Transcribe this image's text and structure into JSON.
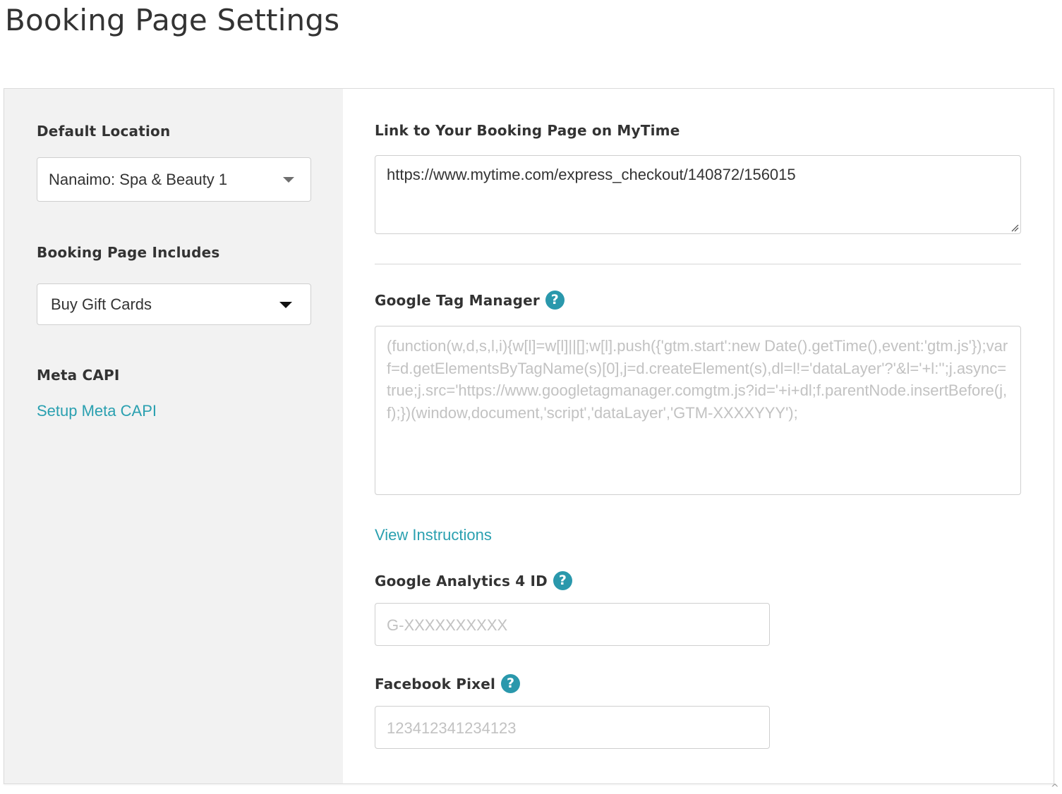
{
  "page": {
    "title": "Booking Page Settings"
  },
  "sidebar": {
    "default_location": {
      "label": "Default Location",
      "value": "Nanaimo: Spa & Beauty 1"
    },
    "booking_page_includes": {
      "label": "Booking Page Includes",
      "value": "Buy Gift Cards"
    },
    "meta_capi": {
      "label": "Meta CAPI",
      "link": "Setup Meta CAPI"
    }
  },
  "main": {
    "booking_link": {
      "label": "Link to Your Booking Page on MyTime",
      "value": "https://www.mytime.com/express_checkout/140872/156015"
    },
    "gtm": {
      "label": "Google Tag Manager",
      "help_icon": "?",
      "placeholder": "(function(w,d,s,l,i){w[l]=w[l]||[];w[l].push({'gtm.start':new Date().getTime(),event:'gtm.js'});var f=d.getElementsByTagName(s)[0],j=d.createElement(s),dl=l!='dataLayer'?'&l='+l:'';j.async=true;j.src='https://www.googletagmanager.comgtm.js?id='+i+dl;f.parentNode.insertBefore(j,f);})(window,document,'script','dataLayer','GTM-XXXXYYY');",
      "view_instructions": "View Instructions"
    },
    "ga4": {
      "label": "Google Analytics 4 ID",
      "help_icon": "?",
      "placeholder": "G-XXXXXXXXXX"
    },
    "facebook_pixel": {
      "label": "Facebook Pixel",
      "help_icon": "?",
      "placeholder": "123412341234123"
    }
  },
  "scroll_indicator": "^",
  "colors": {
    "accent": "#2aa0b0",
    "sidebar_bg": "#f2f2f2",
    "border": "#cfcfcf",
    "placeholder": "#c2c2c2"
  },
  "icons": {
    "help": "question-circle-icon",
    "dropdown": "caret-down-icon",
    "resize": "resize-grip-icon"
  }
}
